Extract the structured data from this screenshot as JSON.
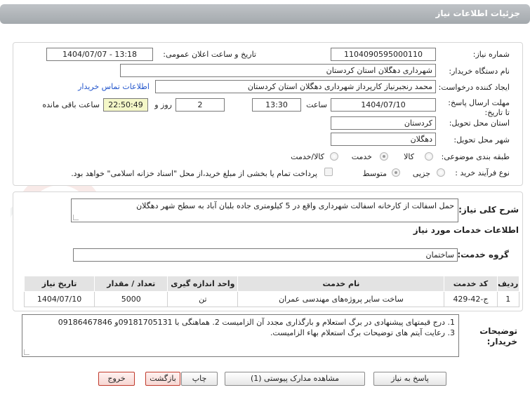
{
  "header": {
    "title": "جزئیات اطلاعات نیاز"
  },
  "labels": {
    "need_number": "شماره نیاز:",
    "announce_datetime": "تاریخ و ساعت اعلان عمومی:",
    "buyer_org": "نام دستگاه خریدار:",
    "requester": "ایجاد کننده درخواست:",
    "buyer_contact": "اطلاعات تماس خریدار",
    "deadline": "مهلت ارسال پاسخ: تا تاریخ:",
    "time_word": "ساعت",
    "day_word": "روز و",
    "remaining": "ساعت باقی مانده",
    "province": "استان محل تحویل:",
    "city": "شهر محل تحویل:",
    "category": "طبقه بندی موضوعی:",
    "process_type": "نوع فرآیند خرید :",
    "need_summary": "شرح کلی نیاز:",
    "services_info": "اطلاعات خدمات مورد نیاز",
    "service_group": "گروه خدمت:",
    "buyer_notes": "توضیحات خریدار:"
  },
  "values": {
    "need_number": "1104090595000110",
    "announce_datetime": "1404/07/07 - 13:18",
    "buyer_org": "شهرداری دهگلان استان کردستان",
    "requester": "محمد رنجبرنیاز کارپرداز شهرداری دهگلان استان کردستان",
    "deadline_date": "1404/07/10",
    "deadline_time": "13:30",
    "days": "2",
    "remaining_time": "22:50:49",
    "province": "کردستان",
    "city": "دهگلان",
    "need_summary": "حمل اسفالت از کارخانه اسفالت شهرداری واقع در 5 کیلومتری جاده بلبان آباد به سطح شهر دهگلان",
    "service_group": "ساختمان",
    "buyer_notes_line1": "1. درج قیمتهای پیشنهادی در برگ استعلام و بارگذاری مجدد آن الزامیست 2. هماهنگی با 09181705131و 09186467846",
    "buyer_notes_line2": "3. رعایت آیتم های توضیحات برگ استعلام بهاء الزامیست."
  },
  "category_options": [
    {
      "label": "کالا",
      "selected": false
    },
    {
      "label": "خدمت",
      "selected": true
    },
    {
      "label": "کالا/خدمت",
      "selected": false
    }
  ],
  "process_options": [
    {
      "label": "جزیی",
      "selected": false
    },
    {
      "label": "متوسط",
      "selected": true
    }
  ],
  "payment_note": "پرداخت تمام یا بخشی از مبلغ خرید،از محل \"اسناد خزانه اسلامی\" خواهد بود.",
  "table": {
    "headers": [
      "ردیف",
      "کد خدمت",
      "نام خدمت",
      "واحد اندازه گیری",
      "تعداد / مقدار",
      "تاریخ نیاز"
    ],
    "rows": [
      [
        "1",
        "ج-42-429",
        "ساخت سایر پروژه‌های مهندسی عمران",
        "تن",
        "5000",
        "1404/07/10"
      ]
    ]
  },
  "buttons": {
    "reply": "پاسخ به نیاز",
    "attachments": "مشاهده مدارک پیوستی (1)",
    "print": "چاپ",
    "back": "بازگشت",
    "exit": "خروج"
  },
  "watermark": "AriaTender.net"
}
